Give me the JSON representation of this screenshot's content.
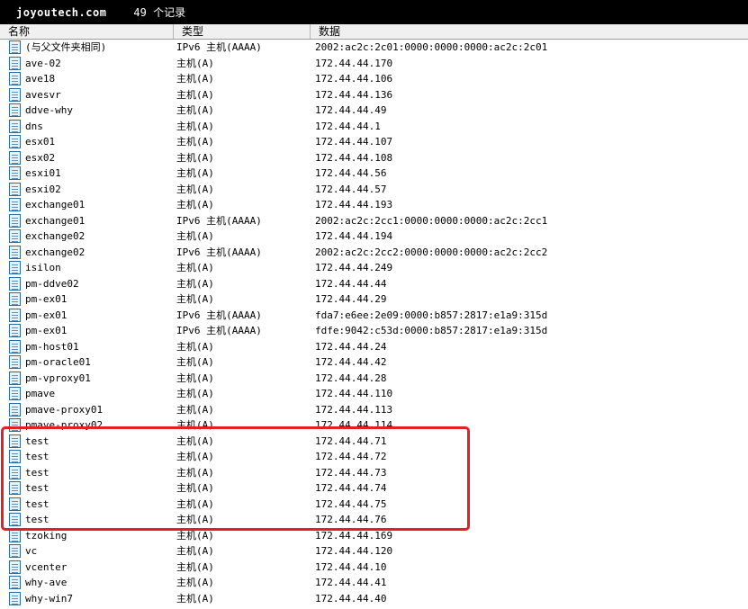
{
  "titlebar": {
    "zone": "joyoutech.com",
    "count": "49 个记录"
  },
  "columns": {
    "name": "名称",
    "type": "类型",
    "data": "数据"
  },
  "highlight_color": "#e41f26",
  "records": [
    {
      "name": "(与父文件夹相同)",
      "type": "IPv6 主机(AAAA)",
      "data": "2002:ac2c:2c01:0000:0000:0000:ac2c:2c01"
    },
    {
      "name": "ave-02",
      "type": "主机(A)",
      "data": "172.44.44.170"
    },
    {
      "name": "ave18",
      "type": "主机(A)",
      "data": "172.44.44.106"
    },
    {
      "name": "avesvr",
      "type": "主机(A)",
      "data": "172.44.44.136"
    },
    {
      "name": "ddve-why",
      "type": "主机(A)",
      "data": "172.44.44.49"
    },
    {
      "name": "dns",
      "type": "主机(A)",
      "data": "172.44.44.1"
    },
    {
      "name": "esx01",
      "type": "主机(A)",
      "data": "172.44.44.107"
    },
    {
      "name": "esx02",
      "type": "主机(A)",
      "data": "172.44.44.108"
    },
    {
      "name": "esxi01",
      "type": "主机(A)",
      "data": "172.44.44.56"
    },
    {
      "name": "esxi02",
      "type": "主机(A)",
      "data": "172.44.44.57"
    },
    {
      "name": "exchange01",
      "type": "主机(A)",
      "data": "172.44.44.193"
    },
    {
      "name": "exchange01",
      "type": "IPv6 主机(AAAA)",
      "data": "2002:ac2c:2cc1:0000:0000:0000:ac2c:2cc1"
    },
    {
      "name": "exchange02",
      "type": "主机(A)",
      "data": "172.44.44.194"
    },
    {
      "name": "exchange02",
      "type": "IPv6 主机(AAAA)",
      "data": "2002:ac2c:2cc2:0000:0000:0000:ac2c:2cc2"
    },
    {
      "name": "isilon",
      "type": "主机(A)",
      "data": "172.44.44.249"
    },
    {
      "name": "pm-ddve02",
      "type": "主机(A)",
      "data": "172.44.44.44"
    },
    {
      "name": "pm-ex01",
      "type": "主机(A)",
      "data": "172.44.44.29"
    },
    {
      "name": "pm-ex01",
      "type": "IPv6 主机(AAAA)",
      "data": "fda7:e6ee:2e09:0000:b857:2817:e1a9:315d"
    },
    {
      "name": "pm-ex01",
      "type": "IPv6 主机(AAAA)",
      "data": "fdfe:9042:c53d:0000:b857:2817:e1a9:315d"
    },
    {
      "name": "pm-host01",
      "type": "主机(A)",
      "data": "172.44.44.24"
    },
    {
      "name": "pm-oracle01",
      "type": "主机(A)",
      "data": "172.44.44.42"
    },
    {
      "name": "pm-vproxy01",
      "type": "主机(A)",
      "data": "172.44.44.28"
    },
    {
      "name": "pmave",
      "type": "主机(A)",
      "data": "172.44.44.110"
    },
    {
      "name": "pmave-proxy01",
      "type": "主机(A)",
      "data": "172.44.44.113"
    },
    {
      "name": "pmave-proxy02",
      "type": "主机(A)",
      "data": "172.44.44.114"
    },
    {
      "name": "test",
      "type": "主机(A)",
      "data": "172.44.44.71"
    },
    {
      "name": "test",
      "type": "主机(A)",
      "data": "172.44.44.72"
    },
    {
      "name": "test",
      "type": "主机(A)",
      "data": "172.44.44.73"
    },
    {
      "name": "test",
      "type": "主机(A)",
      "data": "172.44.44.74"
    },
    {
      "name": "test",
      "type": "主机(A)",
      "data": "172.44.44.75"
    },
    {
      "name": "test",
      "type": "主机(A)",
      "data": "172.44.44.76"
    },
    {
      "name": "tzoking",
      "type": "主机(A)",
      "data": "172.44.44.169"
    },
    {
      "name": "vc",
      "type": "主机(A)",
      "data": "172.44.44.120"
    },
    {
      "name": "vcenter",
      "type": "主机(A)",
      "data": "172.44.44.10"
    },
    {
      "name": "why-ave",
      "type": "主机(A)",
      "data": "172.44.44.41"
    },
    {
      "name": "why-win7",
      "type": "主机(A)",
      "data": "172.44.44.40"
    }
  ]
}
